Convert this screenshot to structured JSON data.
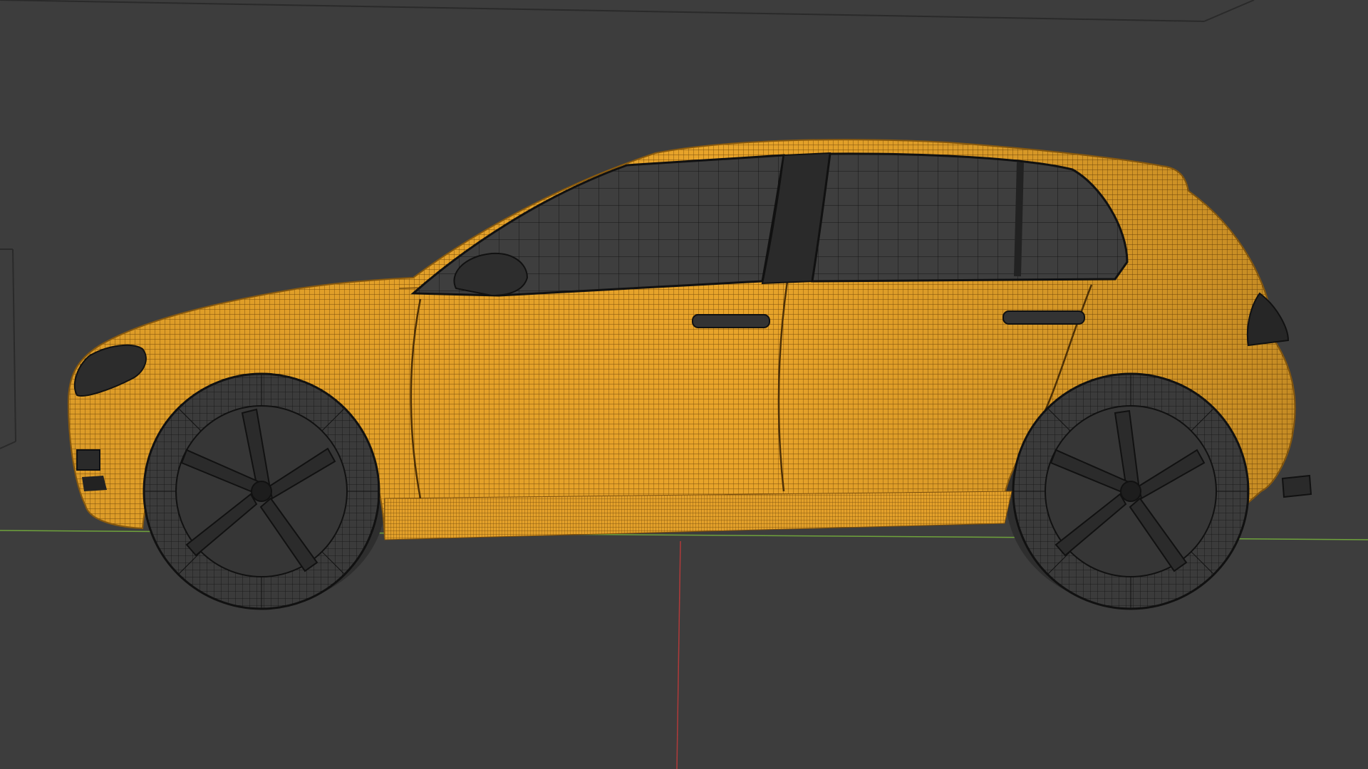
{
  "viewport": {
    "mode": "wireframe",
    "view": "side",
    "background_color": "#3d3d3d"
  },
  "scene": {
    "object": "hatchback car",
    "selected": true,
    "selection_color": "#f0a51e",
    "wire_color": "#1a1a1a",
    "axes": {
      "x_axis_color": "#6fa33c",
      "y_axis_color": "#b03a3a"
    }
  }
}
